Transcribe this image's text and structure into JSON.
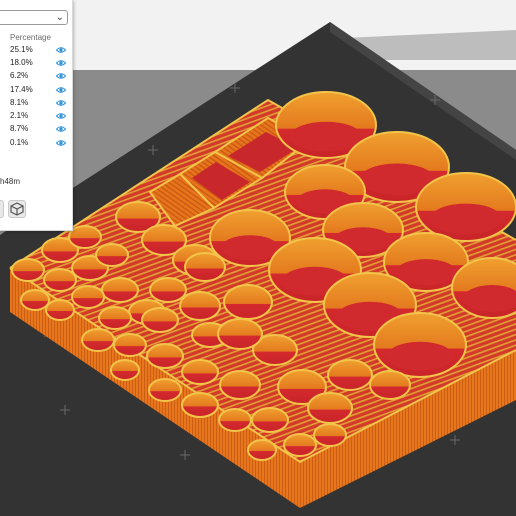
{
  "legend": {
    "header": "Percentage",
    "rows": [
      {
        "value": "25.1%"
      },
      {
        "value": "18.0%"
      },
      {
        "value": "6.2%"
      },
      {
        "value": "17.4%"
      },
      {
        "value": "8.1%"
      },
      {
        "value": "2.1%"
      },
      {
        "value": "8.7%"
      },
      {
        "value": "0.1%"
      }
    ],
    "print_time": "h48m"
  },
  "icons": {
    "visibility": "eye-icon",
    "view": "cube-icon",
    "dropdown": "chevron-down-icon"
  },
  "colors": {
    "bed": "#2e2e2e",
    "background": "#8c8c8c",
    "wall": "#e8741c",
    "wall_outline": "#f2c44a",
    "infill": "#c8282c",
    "accent": "#2a8fd6"
  }
}
